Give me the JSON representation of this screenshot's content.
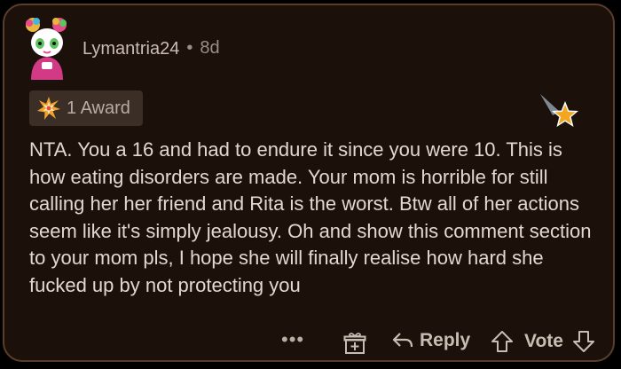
{
  "comment": {
    "username": "Lymantria24",
    "separator": "•",
    "age": "8d",
    "award_label": "1 Award",
    "body": "NTA. You a 16 and had to endure it since you were 10. This is how eating disorders are made. Your mom is horrible for still calling her her friend and Rita is the worst. Btw all of her actions seem like it's simply jealousy. Oh and show this comment section to your mom pls, I hope she will finally realise how hard she fucked up by not protecting you"
  },
  "actions": {
    "more_label": "•••",
    "reply_label": "Reply",
    "vote_label": "Vote"
  },
  "icons": {
    "avatar": "user-avatar",
    "award": "burst-award-icon",
    "badge": "shooting-star-icon",
    "gift": "gift-icon",
    "reply": "reply-arrow-icon",
    "upvote": "upvote-arrow-icon",
    "downvote": "downvote-arrow-icon"
  },
  "colors": {
    "card_background": "#1c100a",
    "card_border": "#5a3e2b",
    "text": "#e2d8d0",
    "muted": "#9a8f88"
  }
}
